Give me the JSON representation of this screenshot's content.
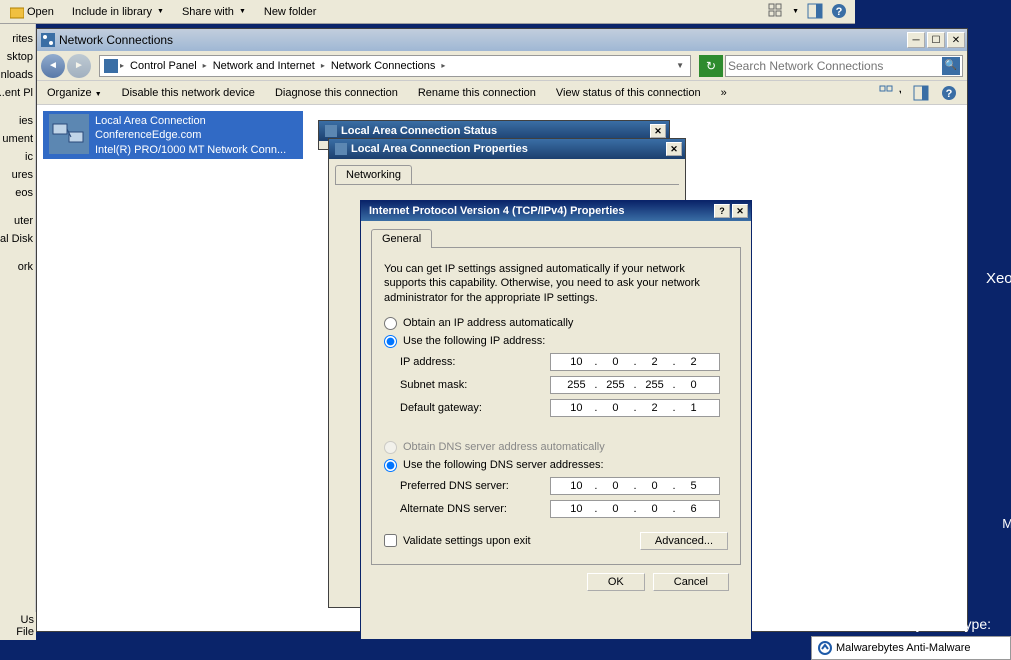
{
  "bg_explorer": {
    "open": "Open",
    "include": "Include in library",
    "share": "Share with",
    "newfolder": "New folder"
  },
  "left_items": [
    "rites",
    "sktop",
    "nloads",
    "ent Pl...",
    "ies",
    "ument",
    "ic",
    "ures",
    "eos",
    "uter",
    "al Disk",
    "ork"
  ],
  "left_bottom": [
    "Us",
    "File"
  ],
  "nc": {
    "title": "Network Connections",
    "breadcrumb": [
      "Control Panel",
      "Network and Internet",
      "Network Connections"
    ],
    "search_placeholder": "Search Network Connections",
    "actions": {
      "organize": "Organize",
      "disable": "Disable this network device",
      "diagnose": "Diagnose this connection",
      "rename": "Rename this connection",
      "viewstatus": "View status of this connection"
    },
    "conn": {
      "name": "Local Area Connection",
      "domain": "ConferenceEdge.com",
      "adapter": "Intel(R) PRO/1000 MT Network Conn..."
    }
  },
  "status_dlg_title": "Local Area Connection Status",
  "prop_dlg": {
    "title": "Local Area Connection Properties",
    "tab": "Networking"
  },
  "ipv4": {
    "title": "Internet Protocol Version 4 (TCP/IPv4) Properties",
    "tab": "General",
    "desc": "You can get IP settings assigned automatically if your network supports this capability. Otherwise, you need to ask your network administrator for the appropriate IP settings.",
    "r_auto": "Obtain an IP address automatically",
    "r_manual": "Use the following IP address:",
    "lbl_ip": "IP address:",
    "lbl_mask": "Subnet mask:",
    "lbl_gw": "Default gateway:",
    "r_dns_auto": "Obtain DNS server address automatically",
    "r_dns_manual": "Use the following DNS server addresses:",
    "lbl_dns1": "Preferred DNS server:",
    "lbl_dns2": "Alternate DNS server:",
    "chk_validate": "Validate settings upon exit",
    "btn_adv": "Advanced...",
    "btn_ok": "OK",
    "btn_cancel": "Cancel",
    "ip": [
      "10",
      "0",
      "2",
      "2"
    ],
    "mask": [
      "255",
      "255",
      "255",
      "0"
    ],
    "gw": [
      "10",
      "0",
      "2",
      "1"
    ],
    "dns1": [
      "10",
      "0",
      "0",
      "5"
    ],
    "dns2": [
      "10",
      "0",
      "0",
      "6"
    ]
  },
  "mwb": {
    "title": "Malwarebytes Anti-Malware"
  },
  "desktop": {
    "system_type": "System Type:",
    "xeon": "Xeon"
  }
}
